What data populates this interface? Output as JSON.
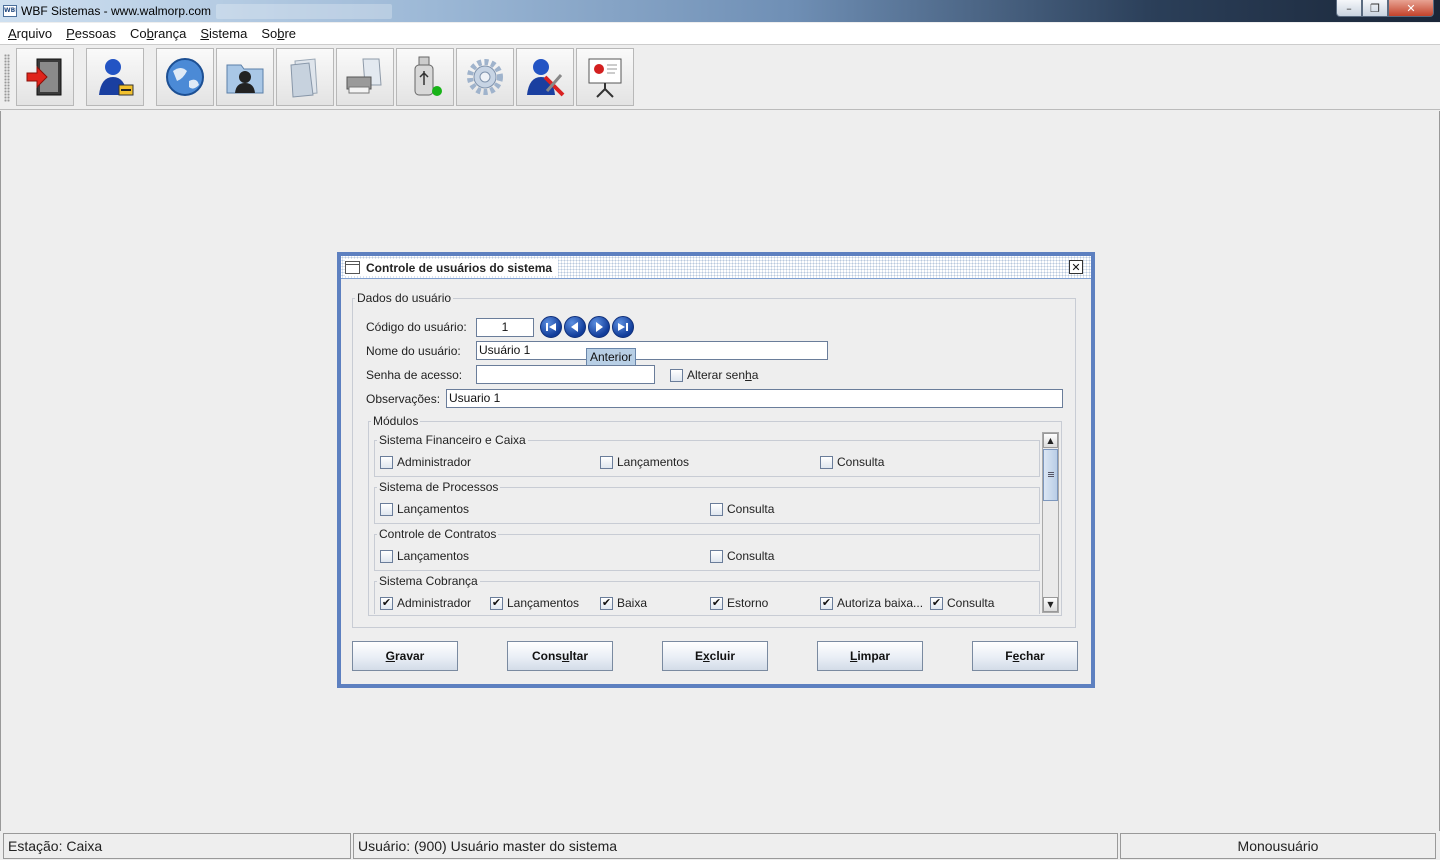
{
  "window": {
    "title": "WBF Sistemas - www.walmorp.com",
    "icon_text": "WBF",
    "controls": [
      "minimize-icon",
      "maximize-icon",
      "close-icon"
    ]
  },
  "menubar": {
    "items": [
      {
        "label_pre": "",
        "mnemonic": "A",
        "label_post": "rquivo"
      },
      {
        "label_pre": "",
        "mnemonic": "P",
        "label_post": "essoas"
      },
      {
        "label_pre": "Co",
        "mnemonic": "b",
        "label_post": "rança"
      },
      {
        "label_pre": "",
        "mnemonic": "S",
        "label_post": "istema"
      },
      {
        "label_pre": "So",
        "mnemonic": "b",
        "label_post": "re"
      }
    ]
  },
  "toolbar": {
    "buttons": [
      "exit-door-icon",
      "user-lock-icon",
      "globe-icon",
      "contacts-folder-icon",
      "documents-folder-icon",
      "printer-icon",
      "usb-drive-icon",
      "settings-gear-icon",
      "user-tools-icon",
      "presentation-board-icon"
    ]
  },
  "dialog": {
    "title": "Controle de usuários do sistema",
    "group_title": "Dados do usuário",
    "codigo_label": "Código do usuário:",
    "codigo_value": "1",
    "nome_label": "Nome do usuário:",
    "nome_value": "Usuário 1",
    "senha_label": "Senha de acesso:",
    "senha_value": "",
    "alterar_senha_pre": "Alterar sen",
    "alterar_senha_mn": "h",
    "alterar_senha_post": "a",
    "obs_label": "Observações:",
    "obs_value": "Usuario 1",
    "tooltip": "Anterior",
    "nav_buttons": [
      "first-record-icon",
      "previous-record-icon",
      "next-record-icon",
      "last-record-icon"
    ],
    "modulos_title": "Módulos",
    "modules": [
      {
        "title": "Sistema Financeiro e Caixa",
        "options": [
          {
            "label": "Administrador",
            "checked": false
          },
          {
            "label": "Lançamentos",
            "checked": false
          },
          {
            "label": "Consulta",
            "checked": false
          }
        ]
      },
      {
        "title": "Sistema de Processos",
        "options": [
          {
            "label": "Lançamentos",
            "checked": false
          },
          {
            "label": "Consulta",
            "checked": false
          }
        ]
      },
      {
        "title": "Controle de Contratos",
        "options": [
          {
            "label": "Lançamentos",
            "checked": false
          },
          {
            "label": "Consulta",
            "checked": false
          }
        ]
      },
      {
        "title": "Sistema Cobrança",
        "options": [
          {
            "label": "Administrador",
            "checked": true
          },
          {
            "label": "Lançamentos",
            "checked": true
          },
          {
            "label": "Baixa",
            "checked": true
          },
          {
            "label": "Estorno",
            "checked": true
          },
          {
            "label": "Autoriza baixa...",
            "checked": true
          },
          {
            "label": "Consulta",
            "checked": true
          }
        ]
      }
    ],
    "buttons": {
      "gravar": {
        "pre": "",
        "mn": "G",
        "post": "ravar"
      },
      "consultar": {
        "pre": "Cons",
        "mn": "u",
        "post": "ltar"
      },
      "excluir": {
        "pre": "E",
        "mn": "x",
        "post": "cluir"
      },
      "limpar": {
        "pre": "",
        "mn": "L",
        "post": "impar"
      },
      "fechar": {
        "pre": "F",
        "mn": "e",
        "post": "char"
      }
    }
  },
  "statusbar": {
    "estacao": "Estação: Caixa",
    "usuario": "Usuário: (900) Usuário master do sistema",
    "modo": "Monousuário"
  },
  "colors": {
    "frame_border": "#5d80c0",
    "nav_button": "#1a4aa8",
    "background": "#eeeeee"
  }
}
